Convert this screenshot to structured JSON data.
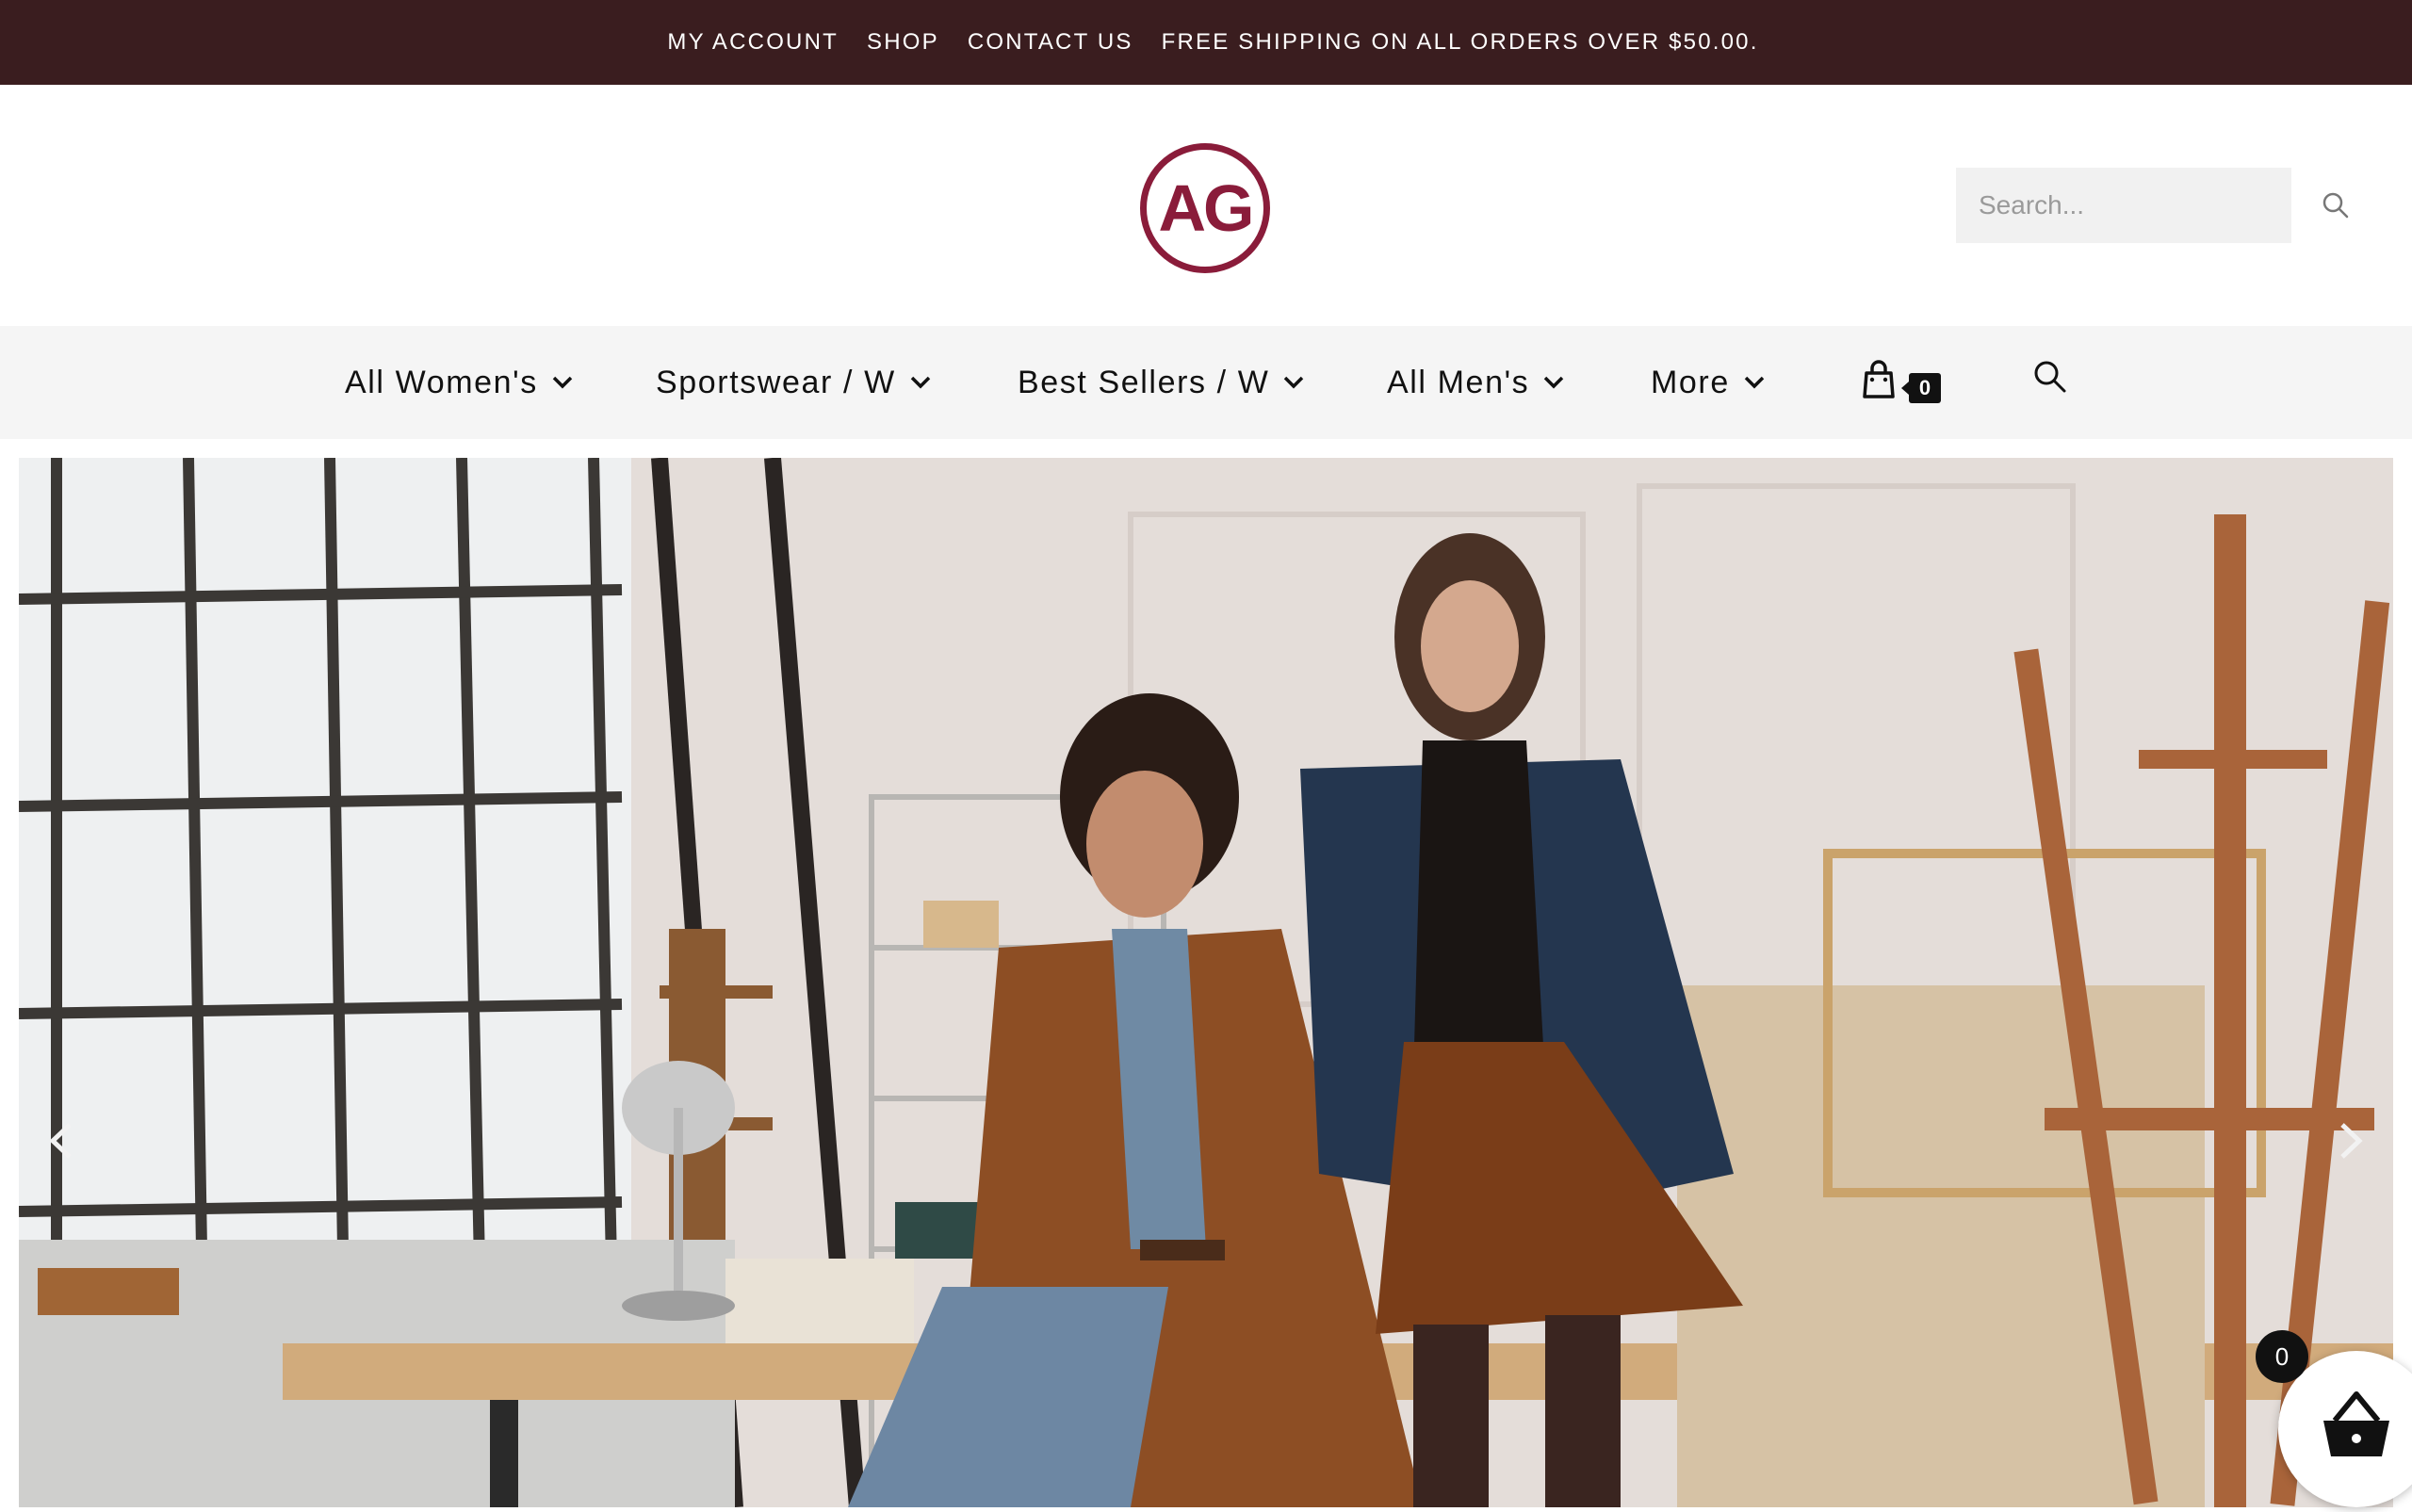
{
  "topbar": {
    "links": [
      "MY ACCOUNT",
      "SHOP",
      "CONTACT US"
    ],
    "promo": "FREE SHIPPING ON ALL ORDERS OVER $50.00.",
    "background": "#3a1d1f"
  },
  "header": {
    "logo_text": "AG",
    "logo_color": "#8a1c3a",
    "search_placeholder": "Search..."
  },
  "nav": {
    "items": [
      "All Women's",
      "Sportswear / W",
      "Best Sellers / W",
      "All Men's",
      "More"
    ],
    "cart_count": "0"
  },
  "floating_cart": {
    "count": "0"
  },
  "icons": [
    "search-icon",
    "chevron-down-icon",
    "shopping-bag-icon",
    "chevron-left-icon",
    "chevron-right-icon",
    "basket-icon"
  ]
}
